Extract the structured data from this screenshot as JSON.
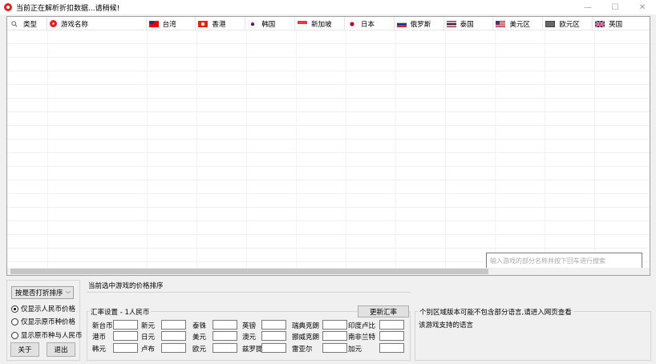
{
  "window": {
    "title": "当前正在解析折扣数据...请稍候!",
    "minimize": "—",
    "maximize": "☐",
    "close": "✕"
  },
  "grid": {
    "columns": [
      {
        "label": "类型",
        "icon": "search-icon"
      },
      {
        "label": "游戏名称",
        "icon": "game-icon"
      },
      {
        "label": "台湾",
        "icon": "flag-taiwan-icon"
      },
      {
        "label": "香港",
        "icon": "flag-hongkong-icon"
      },
      {
        "label": "韩国",
        "icon": "flag-korea-icon"
      },
      {
        "label": "新加坡",
        "icon": "flag-singapore-icon"
      },
      {
        "label": "日本",
        "icon": "flag-japan-icon"
      },
      {
        "label": "俄罗斯",
        "icon": "flag-russia-icon"
      },
      {
        "label": "泰国",
        "icon": "flag-thailand-icon"
      },
      {
        "label": "美元区",
        "icon": "flag-usa-icon"
      },
      {
        "label": "欧元区",
        "icon": "flag-eu-icon"
      },
      {
        "label": "英国",
        "icon": "flag-uk-icon"
      }
    ],
    "search_placeholder": "输入游戏的部分名称并按下回车进行搜索"
  },
  "left_panel": {
    "sort_value": "按是否打折排序",
    "radio_rmb_only": "仅显示人民币价格",
    "radio_original_only": "仅显示原币种价格",
    "radio_both": "显示原币种与人民币",
    "about_button": "关于",
    "exit_button": "退出"
  },
  "middle_panel": {
    "sort_label": "当前选中游戏的价格排序",
    "rate_title": "汇率设置 - 1人民币",
    "update_button": "更新汇率",
    "rates": [
      {
        "label": "新台币"
      },
      {
        "label": "新元"
      },
      {
        "label": "泰铢"
      },
      {
        "label": "英镑"
      },
      {
        "label": "瑞典克朗"
      },
      {
        "label": "印度卢比"
      },
      {
        "label": "港币"
      },
      {
        "label": "日元"
      },
      {
        "label": "美元"
      },
      {
        "label": "澳元"
      },
      {
        "label": "挪威克朗"
      },
      {
        "label": "南非兰特"
      },
      {
        "label": "韩元"
      },
      {
        "label": "卢布"
      },
      {
        "label": "欧元"
      },
      {
        "label": "兹罗提"
      },
      {
        "label": "雷亚尔"
      },
      {
        "label": "加元"
      }
    ]
  },
  "right_panel": {
    "note": "个别区域版本可能不包含部分语言,请进入网页查看",
    "languages_label": "该游戏支持的语言"
  }
}
